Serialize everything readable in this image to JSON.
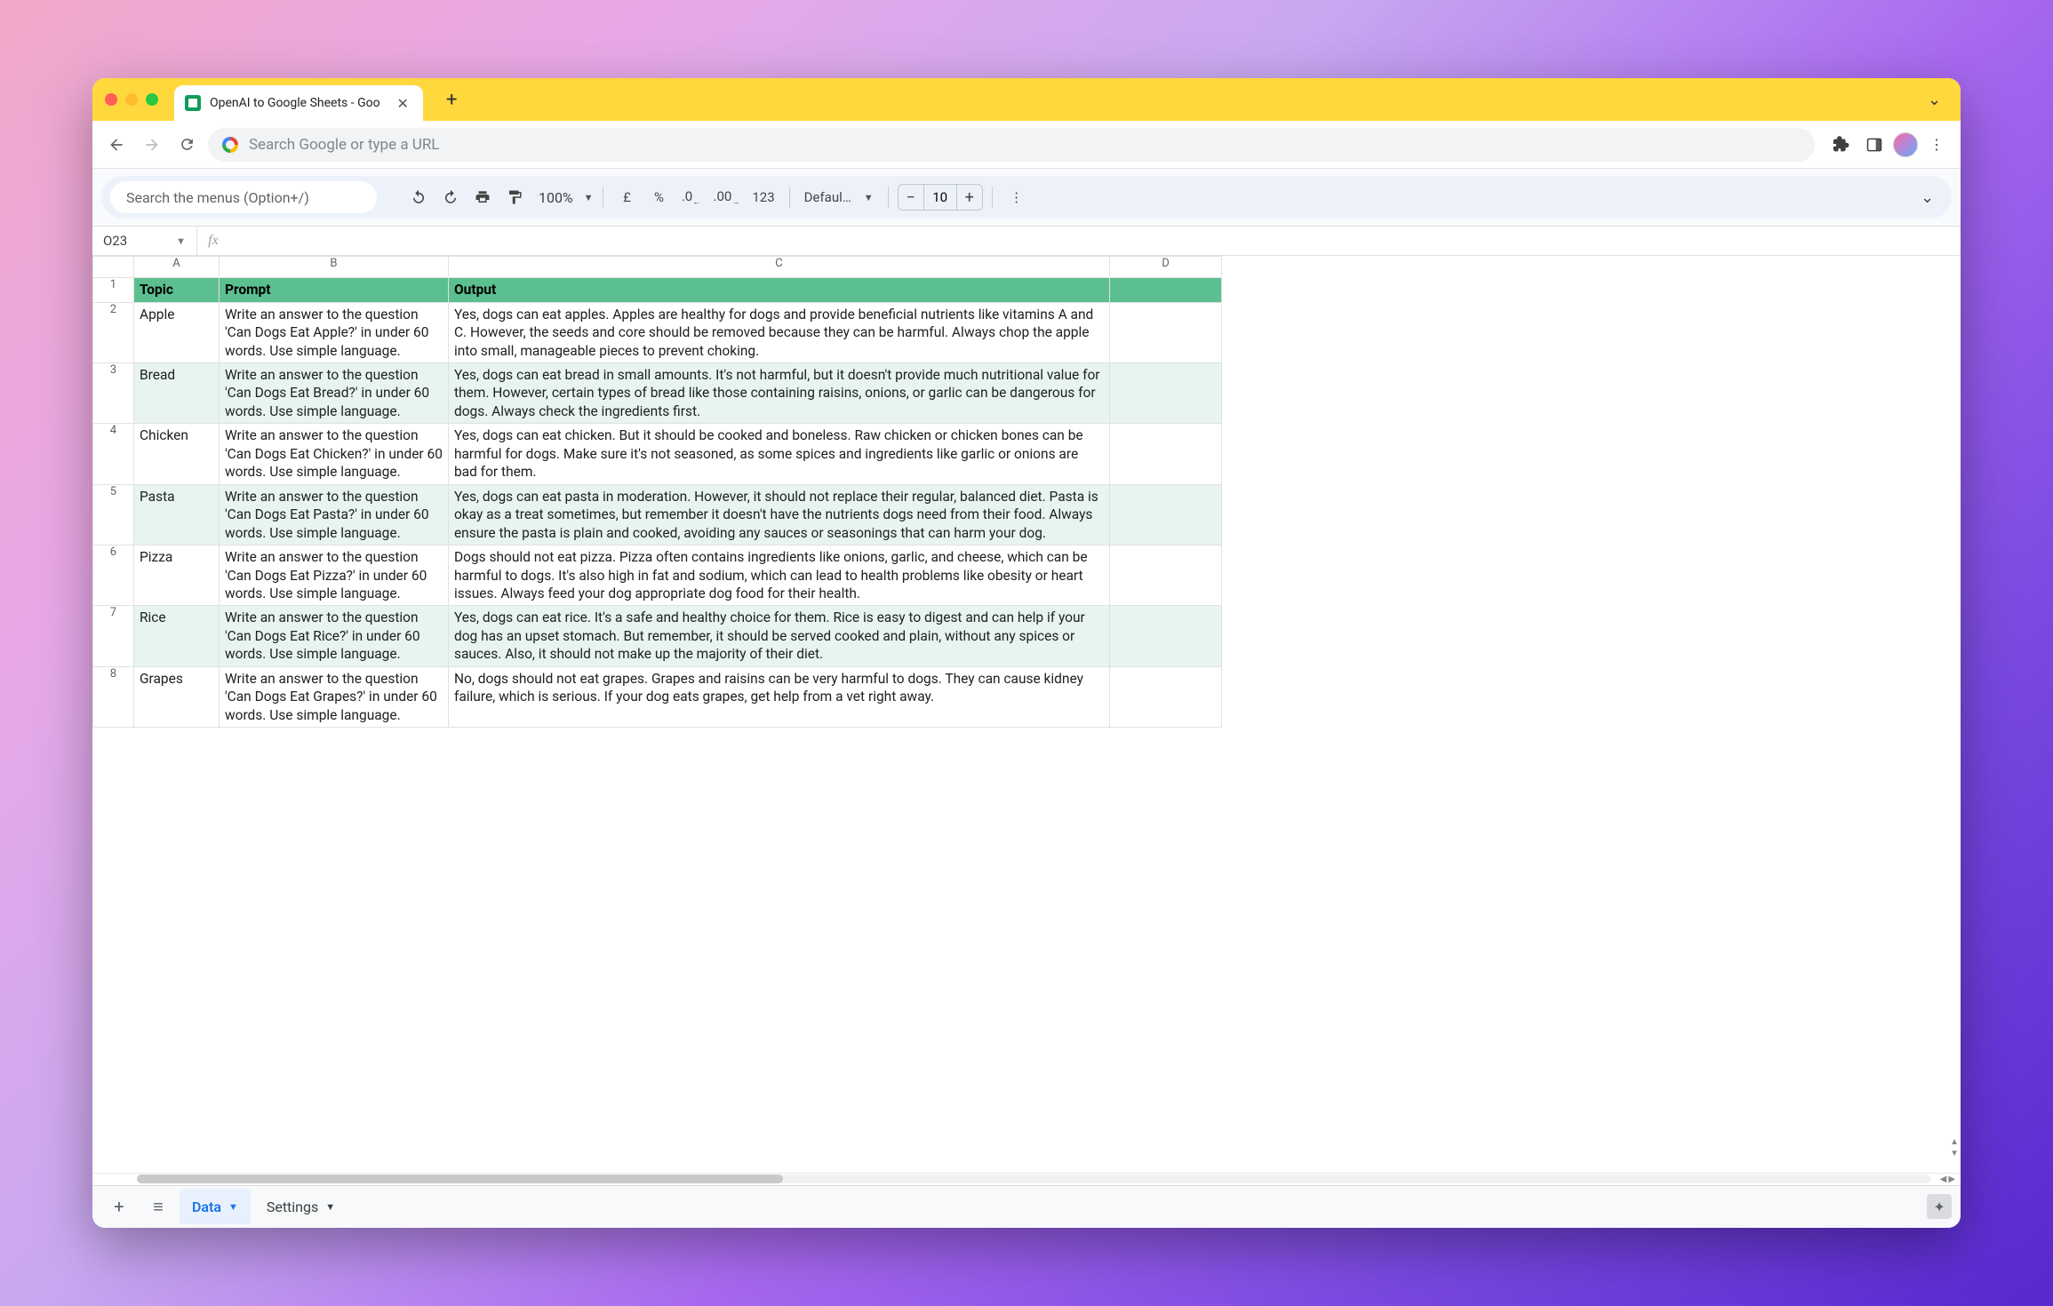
{
  "browser": {
    "tab_title": "OpenAI to Google Sheets - Goo",
    "omnibox_placeholder": "Search Google or type a URL"
  },
  "toolbar": {
    "menu_search_placeholder": "Search the menus (Option+/)",
    "zoom_label": "100%",
    "currency_symbol": "£",
    "percent_symbol": "%",
    "decrease_decimal": ".0",
    "increase_decimal": ".00",
    "format_123": "123",
    "font_name": "Defaul…",
    "font_size": "10"
  },
  "namebox": "O23",
  "columns": [
    "A",
    "B",
    "C",
    "D"
  ],
  "headers": {
    "topic": "Topic",
    "prompt": "Prompt",
    "output": "Output"
  },
  "rows": [
    {
      "n": 2,
      "topic": "Apple",
      "prompt": "Write an answer to the question 'Can Dogs Eat Apple?' in under 60 words. Use simple language.",
      "output": "Yes, dogs can eat apples. Apples are healthy for dogs and provide beneficial nutrients like vitamins A and C. However, the seeds and core should be removed because they can be harmful. Always chop the apple into small, manageable pieces to prevent choking."
    },
    {
      "n": 3,
      "topic": "Bread",
      "prompt": "Write an answer to the question 'Can Dogs Eat Bread?' in under 60 words. Use simple language.",
      "output": "Yes, dogs can eat bread in small amounts. It's not harmful, but it doesn't provide much nutritional value for them. However, certain types of bread like those containing raisins, onions, or garlic can be dangerous for dogs. Always check the ingredients first."
    },
    {
      "n": 4,
      "topic": "Chicken",
      "prompt": "Write an answer to the question 'Can Dogs Eat Chicken?' in under 60 words. Use simple language.",
      "output": "Yes, dogs can eat chicken. But it should be cooked and boneless. Raw chicken or chicken bones can be harmful for dogs. Make sure it's not seasoned, as some spices and ingredients like garlic or onions are bad for them."
    },
    {
      "n": 5,
      "topic": "Pasta",
      "prompt": "Write an answer to the question 'Can Dogs Eat Pasta?' in under 60 words. Use simple language.",
      "output": "Yes, dogs can eat pasta in moderation. However, it should not replace their regular, balanced diet. Pasta is okay as a treat sometimes, but remember it doesn't have the nutrients dogs need from their food. Always ensure the pasta is plain and cooked, avoiding any sauces or seasonings that can harm your dog."
    },
    {
      "n": 6,
      "topic": "Pizza",
      "prompt": "Write an answer to the question 'Can Dogs Eat Pizza?' in under 60 words. Use simple language.",
      "output": "Dogs should not eat pizza. Pizza often contains ingredients like onions, garlic, and cheese, which can be harmful to dogs. It's also high in fat and sodium, which can lead to health problems like obesity or heart issues. Always feed your dog appropriate dog food for their health."
    },
    {
      "n": 7,
      "topic": "Rice",
      "prompt": "Write an answer to the question 'Can Dogs Eat Rice?' in under 60 words. Use simple language.",
      "output": "Yes, dogs can eat rice. It's a safe and healthy choice for them. Rice is easy to digest and can help if your dog has an upset stomach. But remember, it should be served cooked and plain, without any spices or sauces. Also, it should not make up the majority of their diet."
    },
    {
      "n": 8,
      "topic": "Grapes",
      "prompt": "Write an answer to the question 'Can Dogs Eat Grapes?' in under 60 words. Use simple language.",
      "output": "No, dogs should not eat grapes. Grapes and raisins can be very harmful to dogs. They can cause kidney failure, which is serious. If your dog eats grapes, get help from a vet right away."
    }
  ],
  "sheet_tabs": {
    "active": "Data",
    "other": "Settings"
  }
}
